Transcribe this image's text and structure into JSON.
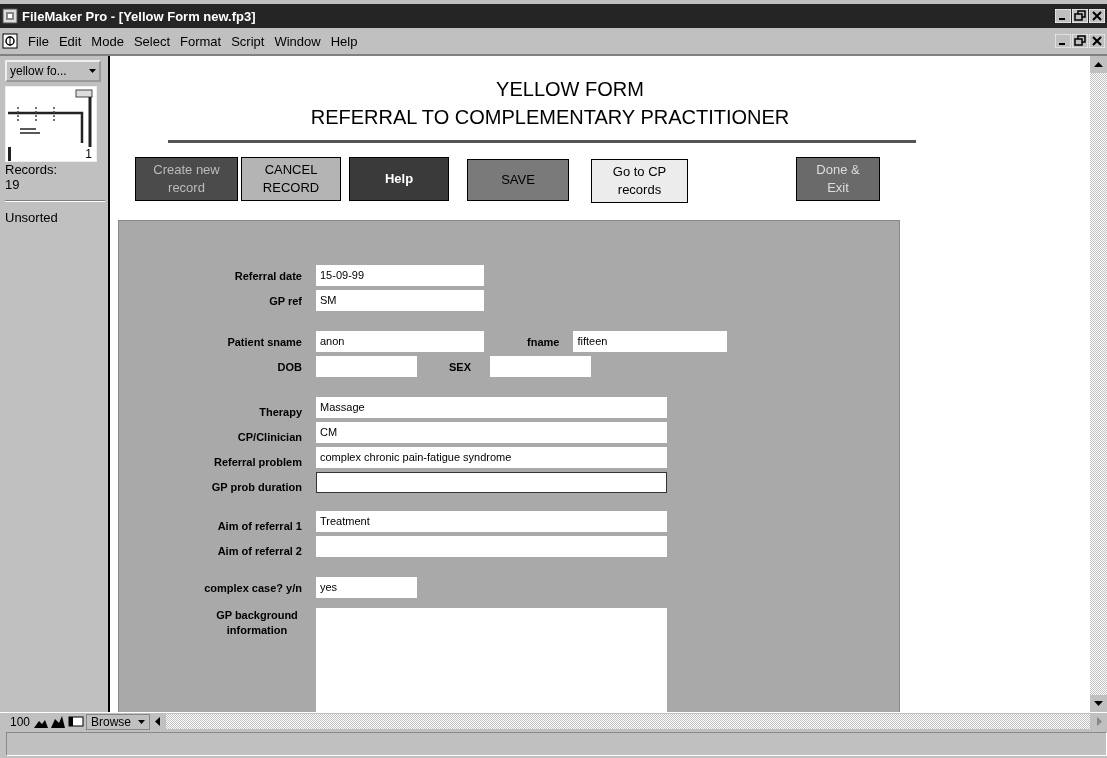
{
  "window": {
    "title": "FileMaker Pro - [Yellow Form new.fp3]"
  },
  "menu": [
    "File",
    "Edit",
    "Mode",
    "Select",
    "Format",
    "Script",
    "Window",
    "Help"
  ],
  "status_area": {
    "layout": "yellow fo...",
    "record_number": "1",
    "records_label": "Records:",
    "records_count": "19",
    "sort_state": "Unsorted"
  },
  "header": {
    "title": "YELLOW FORM",
    "subtitle": "REFERRAL TO COMPLEMENTARY PRACTITIONER"
  },
  "buttons": [
    {
      "label": "Create new record",
      "kind": "dark"
    },
    {
      "label": "CANCEL RECORD",
      "kind": "light"
    },
    {
      "label": "Help",
      "kind": "black"
    },
    {
      "label": "SAVE",
      "kind": "mid"
    },
    {
      "label": "Go to CP records",
      "kind": "pale"
    },
    {
      "label": "Done & Exit",
      "kind": "grey"
    }
  ],
  "form": {
    "groups": [
      [
        {
          "label": "Referral date",
          "value": "15-09-99",
          "kind": "text"
        },
        {
          "label": "GP ref",
          "value": "SM",
          "kind": "text"
        }
      ],
      [
        {
          "label": "Patient sname",
          "value": "anon",
          "kind": "text",
          "second": {
            "label": "fname",
            "value": "fifteen"
          }
        },
        {
          "label": "DOB",
          "kind": "small",
          "second": {
            "label": "SEX"
          }
        }
      ],
      [
        {
          "label": "Therapy",
          "value": "Massage",
          "kind": "wide"
        },
        {
          "label": "CP/Clinician",
          "value": "CM",
          "kind": "wide"
        },
        {
          "label": "Referral problem",
          "value": "complex chronic pain-fatigue syndrome",
          "kind": "wide"
        },
        {
          "label": "GP prob duration",
          "kind": "boxed"
        }
      ],
      [
        {
          "label": "Aim of referral 1",
          "value": "Treatment",
          "kind": "wide"
        },
        {
          "label": "Aim of referral 2",
          "kind": "wide"
        }
      ],
      [
        {
          "label": "complex case? y/n",
          "value": "yes",
          "kind": "small"
        }
      ],
      [
        {
          "label": "GP background information",
          "kind": "area"
        }
      ]
    ]
  },
  "bottom_bar": {
    "zoom": "100",
    "mode": "Browse"
  }
}
